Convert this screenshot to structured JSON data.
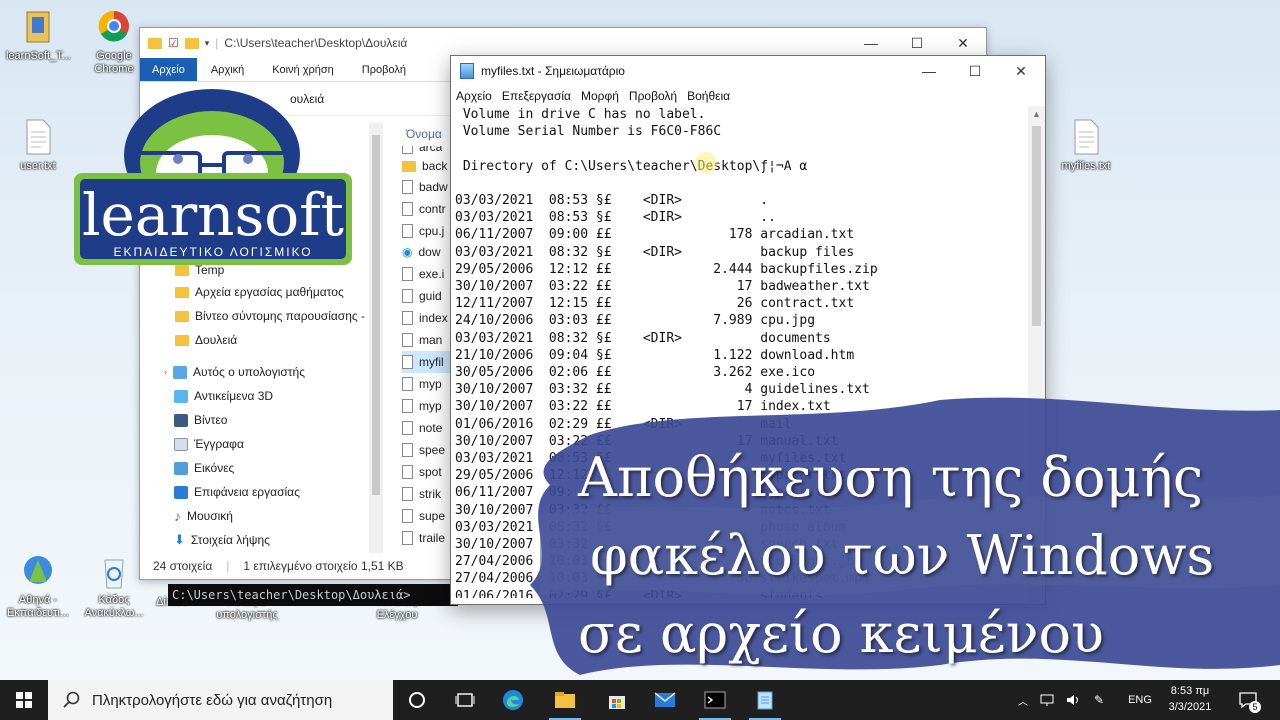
{
  "desktop": {
    "icons": [
      {
        "label": "learnSoft_T...",
        "icon": "app-shortcut-icon"
      },
      {
        "label": "Google Chrome",
        "icon": "chrome-icon"
      },
      {
        "label": "user.txt",
        "icon": "text-file-icon"
      },
      {
        "label": "myfiles.txt",
        "icon": "text-file-icon"
      },
      {
        "label": "Αθηνά - Εκπαιδευτι...",
        "icon": "athena-app-icon"
      },
      {
        "label": "Κάδος Ανακύκλω...",
        "icon": "recycle-bin-icon"
      },
      {
        "label": "Δίκτυο",
        "icon": "network-icon"
      },
      {
        "label": "Αυτός ο υπολογιστής",
        "icon": "this-pc-icon"
      },
      {
        "label": "Πίνακας Ελέγχου",
        "icon": "control-panel-icon"
      }
    ]
  },
  "explorer": {
    "title_path": "C:\\Users\\teacher\\Desktop\\Δουλειά",
    "ribbon_tabs": [
      "Αρχείο",
      "Αρχική",
      "Κοινή χρήση",
      "Προβολή"
    ],
    "address_tail": "ουλειά",
    "column_header": "Όνομα",
    "nav_items": [
      {
        "label": "Temp",
        "icon": "folder-icon"
      },
      {
        "label": "Αρχεία εργασίας μαθήματος",
        "icon": "folder-icon"
      },
      {
        "label": "Βίντεο σύντομης παρουσίασης - ...",
        "icon": "folder-icon"
      },
      {
        "label": "Δουλειά",
        "icon": "folder-icon"
      },
      {
        "label": "Αυτός ο υπολογιστής",
        "icon": "pc-icon"
      },
      {
        "label": "Αντικείμενα 3D",
        "icon": "cube-3d-icon"
      },
      {
        "label": "Βίντεο",
        "icon": "video-icon"
      },
      {
        "label": "Έγγραφα",
        "icon": "documents-icon"
      },
      {
        "label": "Εικόνες",
        "icon": "pictures-icon"
      },
      {
        "label": "Επιφάνεια εργασίας",
        "icon": "desktop-icon"
      },
      {
        "label": "Μουσική",
        "icon": "music-icon"
      },
      {
        "label": "Στοιχεία λήψης",
        "icon": "downloads-icon"
      }
    ],
    "files": [
      "arca",
      "back",
      "badw",
      "contr",
      "cpu.j",
      "dow",
      "exe.i",
      "guid",
      "index",
      "man",
      "myfil",
      "myp",
      "myp",
      "note",
      "spee",
      "spot",
      "strik",
      "supe",
      "traile"
    ],
    "status_count": "24 στοιχεία",
    "status_selected": "1 επιλεγμένο στοιχείο  1,51 KB"
  },
  "cmd": {
    "line": "C:\\Users\\teacher\\Desktop\\Δουλειά>"
  },
  "notepad": {
    "title": "myfiles.txt - Σημειωματάριο",
    "menu": [
      "Αρχείο",
      "Επεξεργασία",
      "Μορφή",
      "Προβολή",
      "Βοήθεια"
    ],
    "content": " Volume in drive C has no label.\n Volume Serial Number is F6C0-F86C\n\n Directory of C:\\Users\\teacher\\Desktop\\ƒ¦¬Α α\n\n03/03/2021  08:53 §£    <DIR>          .\n03/03/2021  08:53 §£    <DIR>          ..\n06/11/2007  09:00 ££               178 arcadian.txt\n03/03/2021  08:32 §£    <DIR>          backup files\n29/05/2006  12:12 ££             2.444 backupfiles.zip\n30/10/2007  03:22 ££                17 badweather.txt\n12/11/2007  12:15 ££                26 contract.txt\n24/10/2006  03:03 ££             7.989 cpu.jpg\n03/03/2021  08:32 §£    <DIR>          documents\n21/10/2006  09:04 §£             1.122 download.htm\n30/05/2006  02:06 ££             3.262 exe.ico\n30/10/2007  03:32 ££                 4 guidelines.txt\n30/10/2007  03:22 ££                17 index.txt\n01/06/2016  02:29 ££    <DIR>          mail\n30/10/2007  03:22 ££                17 manual.txt\n03/03/2021  08:53 §£                   myfiles.txt\n29/05/2006  12:12                      mypaper.txt\n06/11/2007  09:                        mypass.txt\n30/10/2007  03:32 ££                   notes.txt\n03/03/2021  08:32 §£                   photo album\n30/10/2007  03:32                      speech.txt\n27/04/2006  10:03                      spotlight.jpg\n27/04/2006  10:03 §£                58 strikespot.mp3\n01/06/2016  02:29 §£    <DIR>          students"
  },
  "banner": {
    "line1": "Αποθήκευση της δομής",
    "line2": "φακέλου των Windows",
    "line3": "σε αρχείο κειμένου"
  },
  "logo": {
    "brand": "learnsoft",
    "tagline": "ΕΚΠΑΙΔΕΥΤΙΚΟ ΛΟΓΙΣΜΙΚΟ"
  },
  "taskbar": {
    "search_placeholder": "Πληκτρολογήστε εδώ για αναζήτηση",
    "lang": "ENG",
    "time": "8:53 πμ",
    "date": "3/3/2021",
    "notifications": "5"
  },
  "colors": {
    "accent": "#1a5fb4",
    "banner": "#3d4a95",
    "logo_green": "#7dc142",
    "logo_blue": "#1f3c88"
  }
}
